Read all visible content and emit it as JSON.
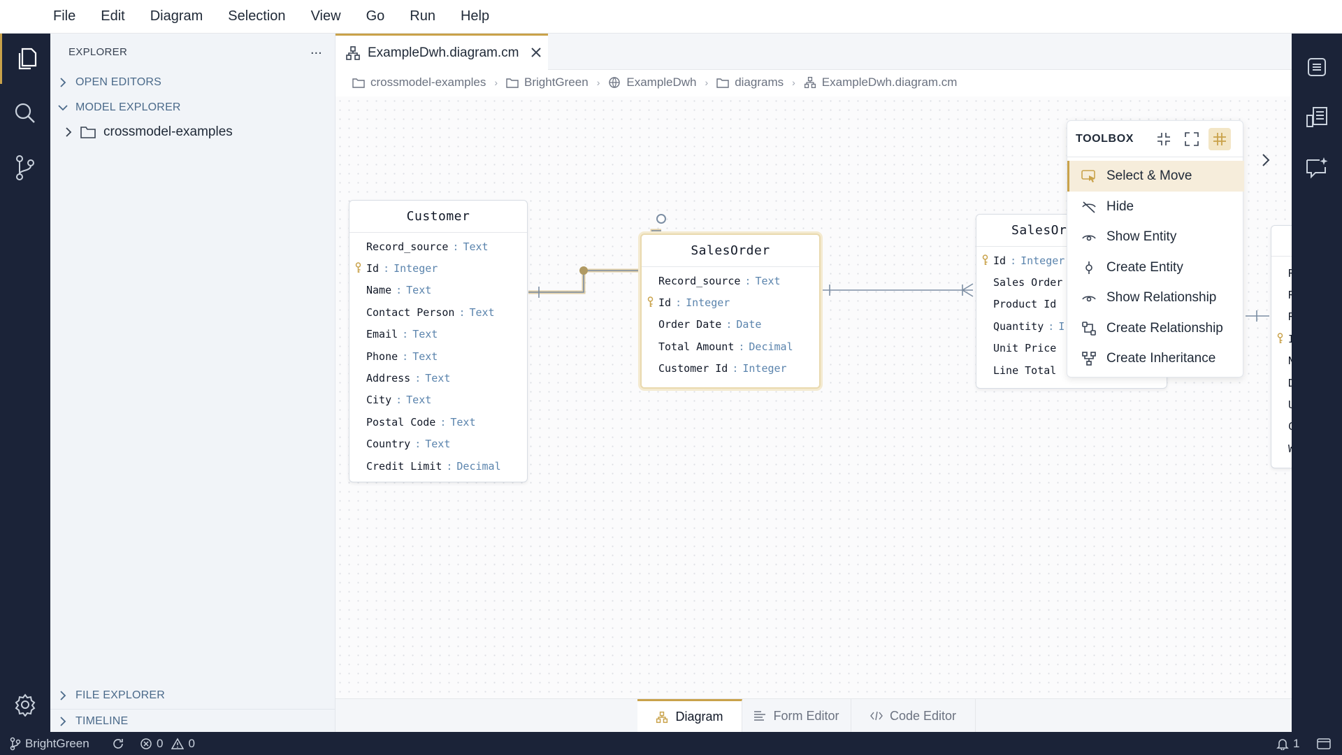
{
  "menu": [
    "File",
    "Edit",
    "Diagram",
    "Selection",
    "View",
    "Go",
    "Run",
    "Help"
  ],
  "sidebar": {
    "title": "EXPLORER",
    "more": "...",
    "sections": {
      "open_editors": "OPEN EDITORS",
      "model_explorer": "MODEL EXPLORER",
      "file_explorer": "FILE EXPLORER",
      "timeline": "TIMELINE"
    },
    "tree": [
      {
        "label": "crossmodel-examples"
      }
    ]
  },
  "tab": {
    "label": "ExampleDwh.diagram.cm"
  },
  "breadcrumb": [
    "crossmodel-examples",
    "BrightGreen",
    "ExampleDwh",
    "diagrams",
    "ExampleDwh.diagram.cm"
  ],
  "entities": {
    "customer": {
      "title": "Customer",
      "attrs": [
        {
          "name": "Record_source",
          "type": "Text"
        },
        {
          "name": "Id",
          "type": "Integer"
        },
        {
          "name": "Name",
          "type": "Text"
        },
        {
          "name": "Contact Person",
          "type": "Text"
        },
        {
          "name": "Email",
          "type": "Text"
        },
        {
          "name": "Phone",
          "type": "Text"
        },
        {
          "name": "Address",
          "type": "Text"
        },
        {
          "name": "City",
          "type": "Text"
        },
        {
          "name": "Postal Code",
          "type": "Text"
        },
        {
          "name": "Country",
          "type": "Text"
        },
        {
          "name": "Credit Limit",
          "type": "Decimal"
        }
      ]
    },
    "salesorder": {
      "title": "SalesOrder",
      "attrs": [
        {
          "name": "Record_source",
          "type": "Text"
        },
        {
          "name": "Id",
          "type": "Integer"
        },
        {
          "name": "Order Date",
          "type": "Date"
        },
        {
          "name": "Total Amount",
          "type": "Decimal"
        },
        {
          "name": "Customer Id",
          "type": "Integer"
        }
      ]
    },
    "salesorderitem": {
      "title": "SalesOr",
      "attrs": [
        {
          "name": "Id",
          "type": "Integer"
        },
        {
          "name": "Sales Order",
          "type": ""
        },
        {
          "name": "Product Id",
          "type": ""
        },
        {
          "name": "Quantity",
          "type": "I"
        },
        {
          "name": "Unit Price",
          "type": ""
        },
        {
          "name": "Line Total",
          "type": ""
        }
      ]
    },
    "partial": {
      "attrs": [
        "R",
        "R",
        "R",
        "I",
        "N",
        "D",
        "U",
        "C",
        "W"
      ]
    }
  },
  "attr_sep": ":",
  "toolbox": {
    "title": "TOOLBOX",
    "items": [
      {
        "label": "Select & Move",
        "icon": "select-move-icon"
      },
      {
        "label": "Hide",
        "icon": "eye-off-icon"
      },
      {
        "label": "Show Entity",
        "icon": "eye-icon"
      },
      {
        "label": "Create Entity",
        "icon": "create-entity-icon"
      },
      {
        "label": "Show Relationship",
        "icon": "eye-icon"
      },
      {
        "label": "Create Relationship",
        "icon": "relationship-icon"
      },
      {
        "label": "Create Inheritance",
        "icon": "inheritance-icon"
      }
    ]
  },
  "editor_tabs": [
    "Diagram",
    "Form Editor",
    "Code Editor"
  ],
  "status": {
    "branch": "BrightGreen",
    "errors": "0",
    "warnings": "0",
    "notifications": "1"
  },
  "colors": {
    "accent": "#c9a24a",
    "dark_bg": "#1b2338",
    "type_text": "#5b84ad",
    "edge_highlight": "#7c8ea3"
  }
}
